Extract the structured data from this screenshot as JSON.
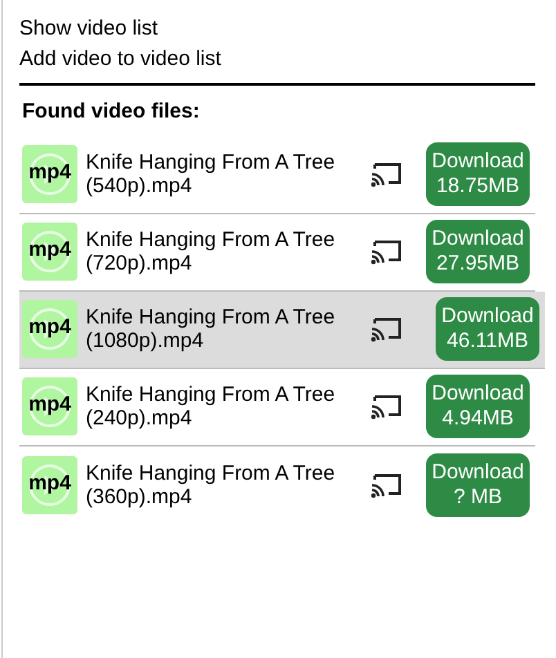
{
  "menu": [
    "Show video list",
    "Add video to video list"
  ],
  "heading": "Found video files:",
  "videos": [
    {
      "format": "mp4",
      "title": "Knife Hanging From A Tree (540p).mp4",
      "button_label": "Download",
      "size": "18.75MB",
      "selected": false
    },
    {
      "format": "mp4",
      "title": "Knife Hanging From A Tree (720p).mp4",
      "button_label": "Download",
      "size": "27.95MB",
      "selected": false
    },
    {
      "format": "mp4",
      "title": "Knife Hanging From A Tree (1080p).mp4",
      "button_label": "Download",
      "size": "46.11MB",
      "selected": true
    },
    {
      "format": "mp4",
      "title": "Knife Hanging From A Tree (240p).mp4",
      "button_label": "Download",
      "size": "4.94MB",
      "selected": false
    },
    {
      "format": "mp4",
      "title": "Knife Hanging From A Tree (360p).mp4",
      "button_label": "Download",
      "size": "? MB",
      "selected": false
    }
  ]
}
